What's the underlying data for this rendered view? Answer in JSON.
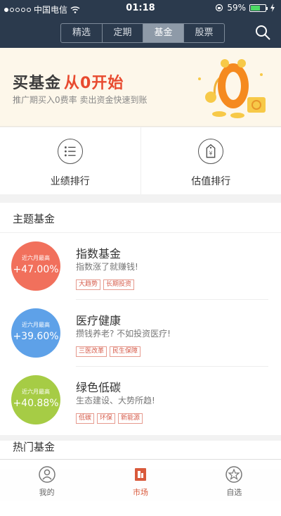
{
  "status_bar": {
    "carrier": "中国电信",
    "time": "01:18",
    "battery": "59%",
    "battery_level": 0.59
  },
  "nav": {
    "tabs": [
      {
        "label": "精选",
        "active": false
      },
      {
        "label": "定期",
        "active": false
      },
      {
        "label": "基金",
        "active": true
      },
      {
        "label": "股票",
        "active": false
      }
    ],
    "search_icon": "search-icon"
  },
  "banner": {
    "title": "买基金",
    "title_highlight": "从0开始",
    "subtitle": "推广期买入0费率 卖出资金快速到账",
    "accent": "#e84a2f"
  },
  "shortcuts": [
    {
      "label": "业绩排行",
      "icon": "list-icon"
    },
    {
      "label": "估值排行",
      "icon": "price-tag-icon"
    }
  ],
  "theme_funds": {
    "title": "主题基金",
    "items": [
      {
        "caption": "近六月最高",
        "return": "+47.00%",
        "name": "指数基金",
        "desc": "指数涨了就赚钱!",
        "tags": [
          "大趋势",
          "长期投资"
        ],
        "color": "#f1705c"
      },
      {
        "caption": "近六月最高",
        "return": "+39.60%",
        "name": "医疗健康",
        "desc": "攒钱养老? 不如投资医疗!",
        "tags": [
          "三医改革",
          "民生保障"
        ],
        "color": "#5ea1e8"
      },
      {
        "caption": "近六月最高",
        "return": "+40.88%",
        "name": "绿色低碳",
        "desc": "生态建设、大势所趋!",
        "tags": [
          "低碳",
          "环保",
          "新能源"
        ],
        "color": "#a6cc45"
      }
    ]
  },
  "hot_funds": {
    "title": "热门基金"
  },
  "bottom_nav": [
    {
      "label": "我的",
      "icon": "user-icon",
      "active": false
    },
    {
      "label": "市场",
      "icon": "market-icon",
      "active": true
    },
    {
      "label": "自选",
      "icon": "star-icon",
      "active": false
    }
  ]
}
